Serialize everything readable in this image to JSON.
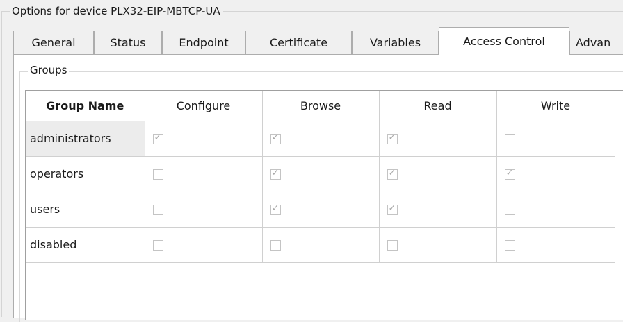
{
  "window": {
    "options_legend": "Options for device PLX32-EIP-MBTCP-UA"
  },
  "tabs": [
    {
      "label": "General",
      "active": false
    },
    {
      "label": "Status",
      "active": false
    },
    {
      "label": "Endpoint",
      "active": false
    },
    {
      "label": "Certificate",
      "active": false
    },
    {
      "label": "Variables",
      "active": false
    },
    {
      "label": "Access Control",
      "active": true
    },
    {
      "label": "Advan",
      "active": false
    }
  ],
  "groups": {
    "legend": "Groups",
    "columns": [
      "Group Name",
      "Configure",
      "Browse",
      "Read",
      "Write"
    ],
    "rows": [
      {
        "name": "administrators",
        "configure": true,
        "browse": true,
        "read": true,
        "write": false
      },
      {
        "name": "operators",
        "configure": false,
        "browse": true,
        "read": true,
        "write": true
      },
      {
        "name": "users",
        "configure": false,
        "browse": true,
        "read": true,
        "write": false
      },
      {
        "name": "disabled",
        "configure": false,
        "browse": false,
        "read": false,
        "write": false
      }
    ]
  },
  "colors": {
    "window_bg": "#f0f0f0",
    "panel_bg": "#ffffff",
    "border": "#adadad",
    "checkmark": "#a9a9a9"
  }
}
